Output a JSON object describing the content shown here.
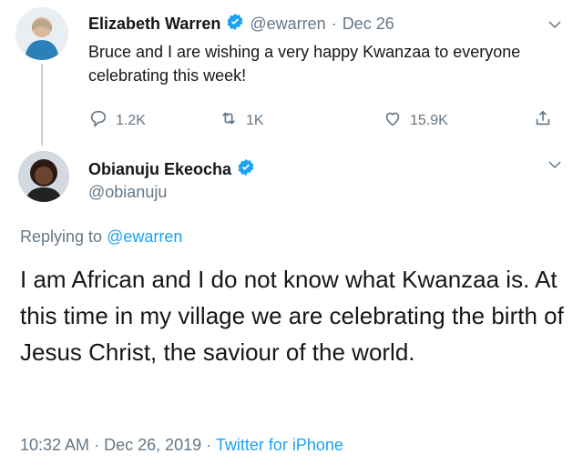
{
  "tweet1": {
    "author_name": "Elizabeth Warren",
    "handle": "@ewarren",
    "separator": "·",
    "date": "Dec 26",
    "text": "Bruce and I are wishing a very happy Kwanzaa to everyone celebrating this week!",
    "replies": "1.2K",
    "retweets": "1K",
    "likes": "15.9K",
    "verified": true
  },
  "tweet2": {
    "author_name": "Obianuju Ekeocha",
    "handle": "@obianuju",
    "verified": true,
    "replying_prefix": "Replying to",
    "replying_to": "@ewarren",
    "text": "I am African and I do not know what Kwanzaa is. At this time in my village we are celebrating the birth of Jesus Christ, the saviour of the world.",
    "time": "10:32 AM",
    "separator": "·",
    "date": "Dec 26, 2019",
    "separator2": "·",
    "source": "Twitter for iPhone"
  },
  "colors": {
    "accent": "#1da1f2",
    "muted": "#657786",
    "text": "#14171a"
  },
  "icons": {
    "reply": "reply-icon",
    "retweet": "retweet-icon",
    "like": "heart-icon",
    "share": "share-icon",
    "menu": "chevron-down-icon",
    "verified": "verified-badge-icon"
  }
}
